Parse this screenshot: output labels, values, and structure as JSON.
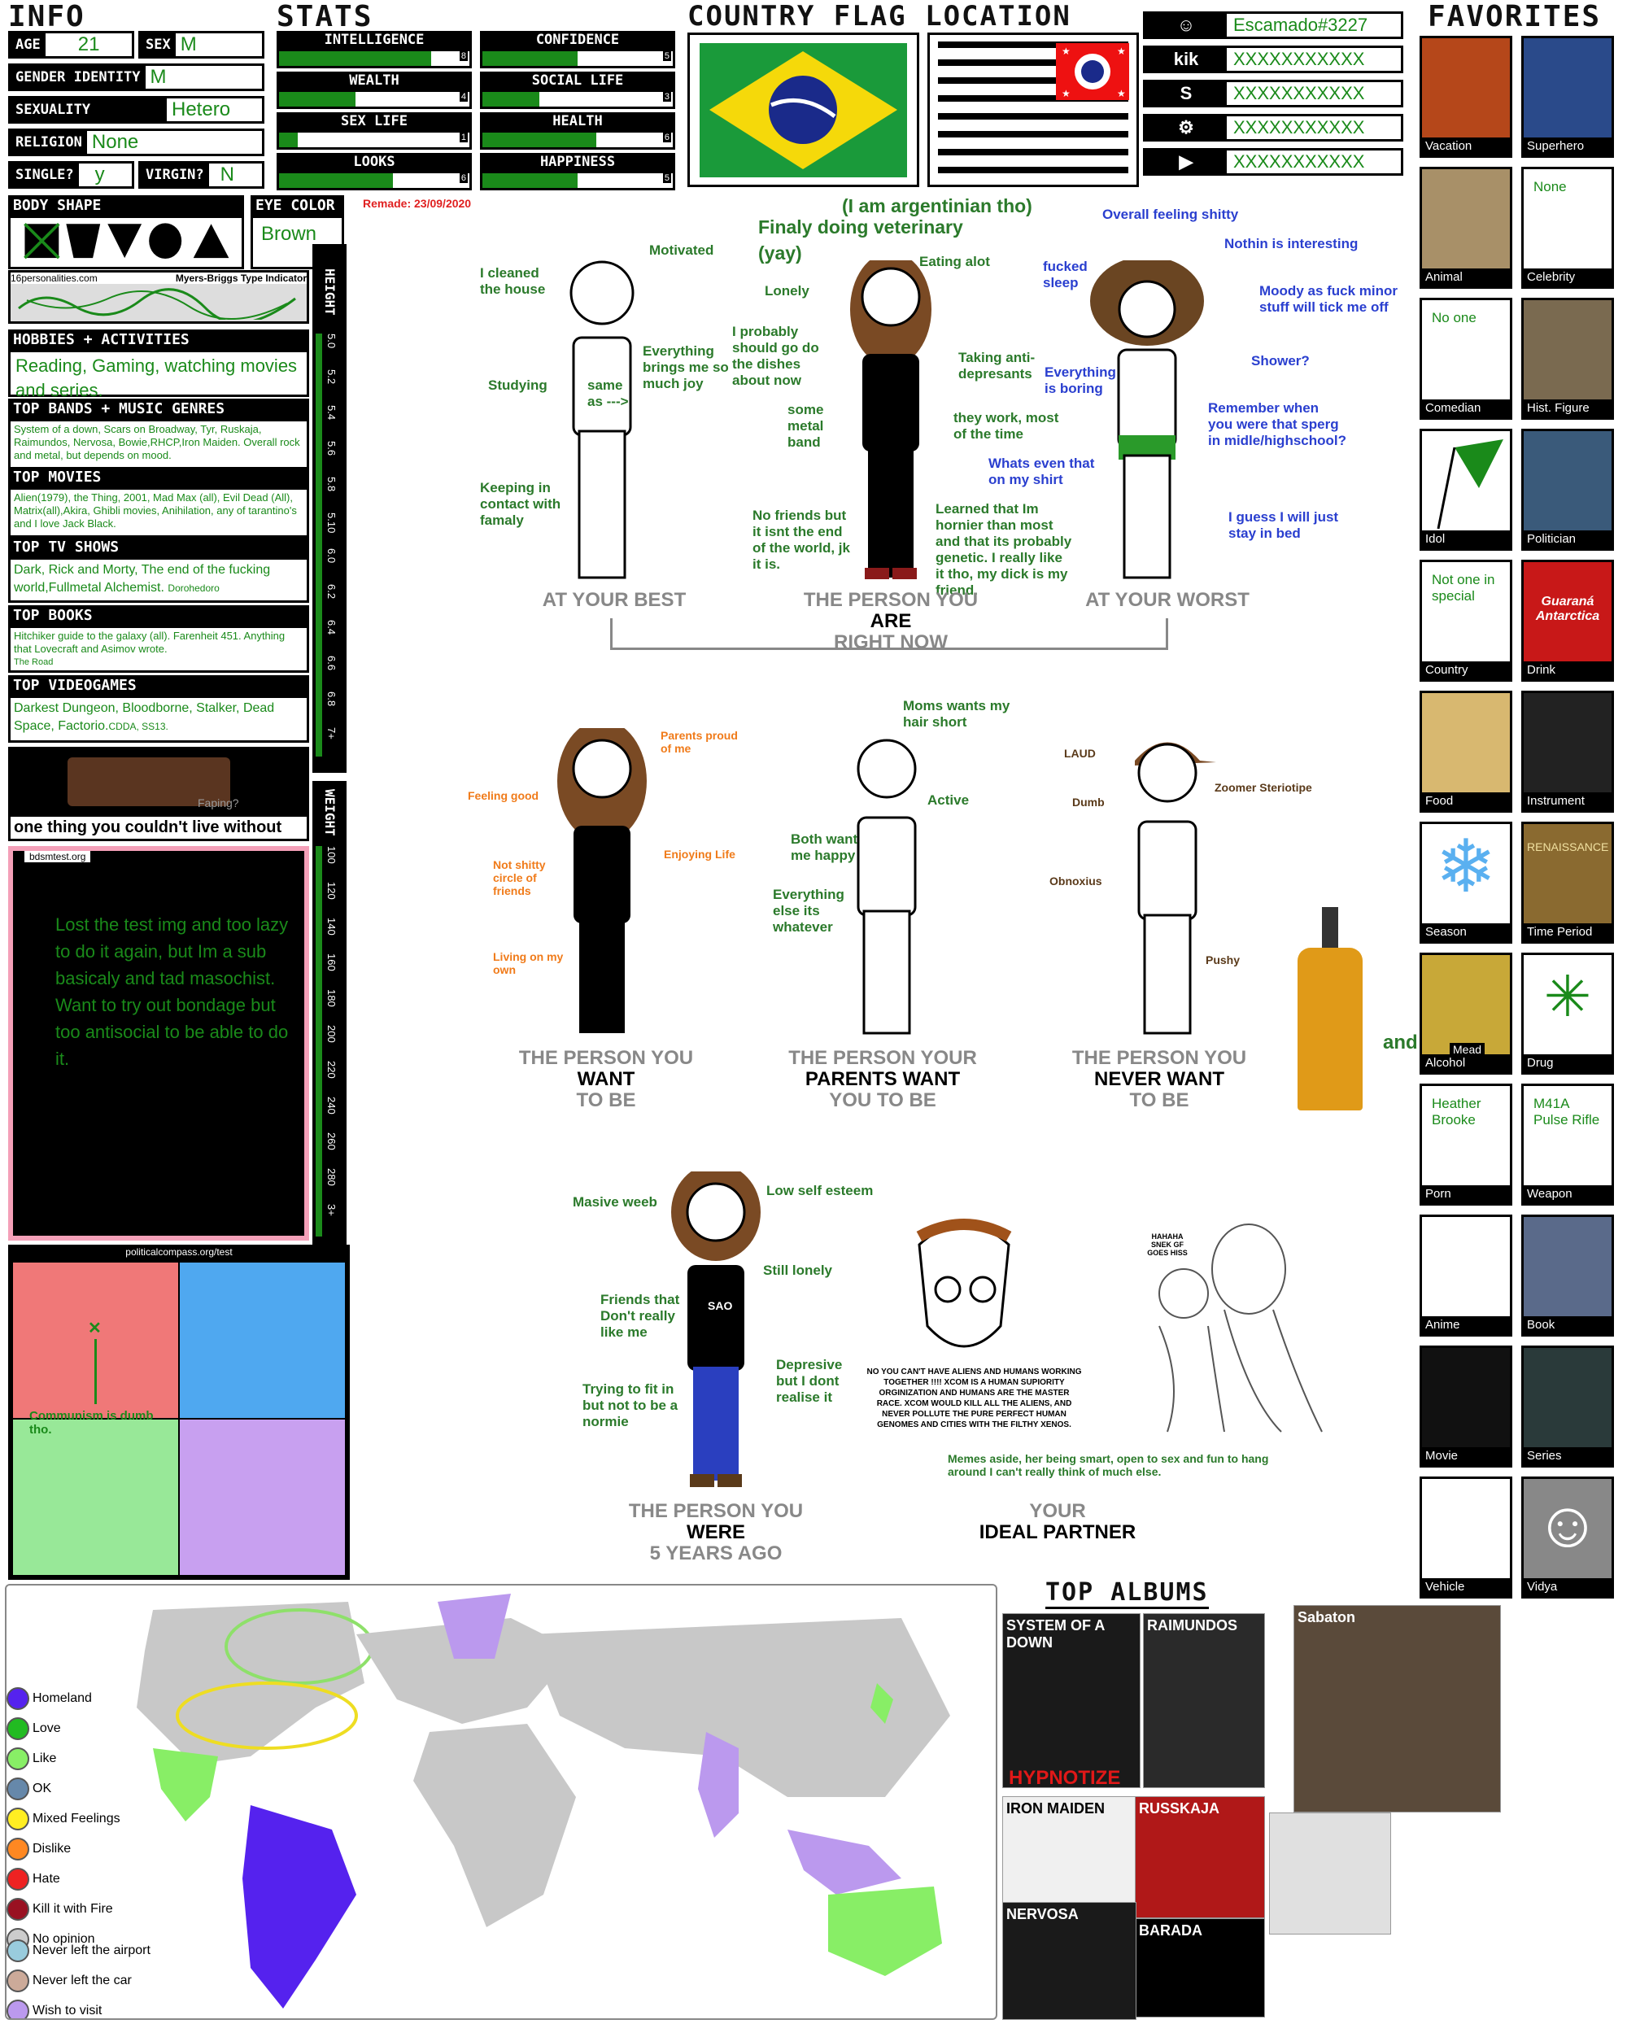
{
  "info": {
    "title": "INFO",
    "age_label": "AGE",
    "age": "21",
    "sex_label": "SEX",
    "sex": "M",
    "gender_label": "GENDER IDENTITY",
    "gender": "M",
    "sexuality_label": "SEXUALITY",
    "sexuality": "Hetero",
    "religion_label": "RELIGION",
    "religion": "None",
    "single_label": "SINGLE?",
    "single": "y",
    "virgin_label": "VIRGIN?",
    "virgin": "N"
  },
  "stats": {
    "title": "STATS",
    "items": [
      {
        "label": "INTELLIGENCE",
        "value": 8
      },
      {
        "label": "CONFIDENCE",
        "value": 5
      },
      {
        "label": "WEALTH",
        "value": 4
      },
      {
        "label": "SOCIAL LIFE",
        "value": 3
      },
      {
        "label": "SEX LIFE",
        "value": 1
      },
      {
        "label": "HEALTH",
        "value": 6
      },
      {
        "label": "LOOKS",
        "value": 6
      },
      {
        "label": "HAPPINESS",
        "value": 5
      }
    ]
  },
  "flags": {
    "title": "COUNTRY FLAG LOCATION"
  },
  "accounts": [
    {
      "icon": "discord-icon",
      "value": "Escamado#3227"
    },
    {
      "icon": "kik-icon",
      "value": "XXXXXXXXXXX"
    },
    {
      "icon": "skype-icon",
      "value": "XXXXXXXXXXX"
    },
    {
      "icon": "steam-icon",
      "value": "XXXXXXXXXXX"
    },
    {
      "icon": "youtube-icon",
      "value": "XXXXXXXXXXX"
    }
  ],
  "favorites": {
    "title": "FAVORITES",
    "items": [
      {
        "cap": "Vacation",
        "text": ""
      },
      {
        "cap": "Superhero",
        "text": ""
      },
      {
        "cap": "Animal",
        "text": ""
      },
      {
        "cap": "Celebrity",
        "text": "None"
      },
      {
        "cap": "Comedian",
        "text": "No one"
      },
      {
        "cap": "Hist. Figure",
        "text": ""
      },
      {
        "cap": "Idol",
        "text": ""
      },
      {
        "cap": "Politician",
        "text": ""
      },
      {
        "cap": "Country",
        "text": "Not one in special"
      },
      {
        "cap": "Drink",
        "text": ""
      },
      {
        "cap": "Food",
        "text": ""
      },
      {
        "cap": "Instrument",
        "text": ""
      },
      {
        "cap": "Season",
        "text": ""
      },
      {
        "cap": "Time Period",
        "text": ""
      },
      {
        "cap": "Alcohol",
        "text": ""
      },
      {
        "cap": "Drug",
        "text": ""
      },
      {
        "cap": "Porn",
        "text": "Heather Brooke"
      },
      {
        "cap": "Weapon",
        "text": "M41A Pulse Rifle"
      },
      {
        "cap": "Anime",
        "text": ""
      },
      {
        "cap": "Book",
        "text": ""
      },
      {
        "cap": "Movie",
        "text": ""
      },
      {
        "cap": "Series",
        "text": ""
      },
      {
        "cap": "Vehicle",
        "text": ""
      },
      {
        "cap": "Vidya",
        "text": ""
      }
    ],
    "mead_label": "Mead",
    "and_label": "and",
    "drink_brand": "Guaraná Antarctica",
    "time_period_sign": "RENAISSANCE"
  },
  "body": {
    "shape_title": "BODY SHAPE",
    "eye_title": "EYE COLOR",
    "eye": "Brown",
    "remade": "Remade: 23/09/2020",
    "mbti_site": "16personalities.com",
    "mbti_title": "Myers-Briggs Type Indicator",
    "height_label": "HEIGHT",
    "weight_label": "WEIGHT",
    "height_ticks": [
      "5.0",
      "5.2",
      "5.4",
      "5.6",
      "5.8",
      "5.10",
      "6.0",
      "6.2",
      "6.4",
      "6.6",
      "6.8",
      "7+"
    ],
    "weight_ticks": [
      "100",
      "120",
      "140",
      "160",
      "180",
      "200",
      "220",
      "240",
      "260",
      "280",
      "3+"
    ]
  },
  "lists": {
    "hobbies_title": "HOBBIES + ACTIVITIES",
    "hobbies": "Reading, Gaming, watching movies and series.",
    "bands_title": "TOP BANDS + MUSIC GENRES",
    "bands": "System of a down, Scars on Broadway, Tyr, Ruskaja, Raimundos, Nervosa, Bowie,RHCP,Iron Maiden. Overall rock and metal, but depends on mood.",
    "movies_title": "TOP MOVIES",
    "movies": "Alien(1979), the Thing, 2001, Mad Max (all), Evil Dead (All), Matrix(all),Akira, Ghibli movies, Anihilation, any of tarantino's and I love Jack Black.",
    "tv_title": "TOP TV SHOWS",
    "tv": "Dark, Rick and Morty, The end of the fucking world,Fullmetal Alchemist.",
    "tv_small": "Dorohedoro",
    "books_title": "TOP BOOKS",
    "books": "Hitchiker guide to the galaxy (all). Farenheit 451. Anything that Lovecraft and Asimov wrote.",
    "books_small": "The Road",
    "games_title": "TOP VIDEOGAMES",
    "games": "Darkest Dungeon, Bloodborne, Stalker, Dead Space, Factorio.",
    "games_small": "CDDA, SS13.",
    "couldnt_live": "one thing you couldn't live without",
    "faping": "Faping?"
  },
  "bdsm": {
    "site": "bdsmtest.org",
    "text": "Lost the test img and too lazy to do it again, but Im a sub basicaly and tad masochist. Want to try out bondage but too antisocial to be able to do it."
  },
  "compass": {
    "site": "politicalcompass.org/test",
    "note": "Communism is dumb tho."
  },
  "comic": {
    "heading1": "(I am argentinian tho)",
    "heading2": "Finaly doing veterinary",
    "heading3": "(yay)",
    "best": [
      "I cleaned the house",
      "Motivated",
      "Studying",
      "same as --->",
      "Everything brings me so much joy",
      "Keeping in contact with famaly"
    ],
    "now": [
      "Lonely",
      "Eating alot",
      "I probably should go do the dishes about now",
      "some metal band",
      "Taking anti-depresants",
      "they work, most of the time",
      "No friends but it isnt the end of the world, jk it is.",
      "Learned that Im hornier than most and that its probably genetic. I really like it tho, my dick is my friend."
    ],
    "worst": [
      "Overall feeling shitty",
      "Nothin is interesting",
      "fucked sleep",
      "Moody as fuck minor stuff will tick me off",
      "Everything is boring",
      "Shower?",
      "Remember when you were that sperg in midle/highschool?",
      "Whats even that on my shirt",
      "I guess I will just stay in bed"
    ],
    "cap_best": "AT YOUR BEST",
    "cap_now1": "THE PERSON YOU",
    "cap_now2": "ARE",
    "cap_now3": "RIGHT NOW",
    "cap_worst": "AT YOUR WORST",
    "want": [
      "Parents proud of me",
      "Feeling good",
      "Enjoying Life",
      "Not shitty circle of friends",
      "Living on my own"
    ],
    "parents": [
      "Moms wants my hair short",
      "Active",
      "Both want me happy",
      "Everything else its whatever"
    ],
    "never": [
      "LAUD",
      "Dumb",
      "Zoomer Steriotipe",
      "Obnoxius",
      "Pushy"
    ],
    "cap_want1": "THE PERSON YOU",
    "cap_want2": "WANT",
    "cap_want3": "TO BE",
    "cap_par1": "THE PERSON YOUR",
    "cap_par2": "PARENTS WANT",
    "cap_par3": "YOU TO BE",
    "cap_nev1": "THE PERSON YOU",
    "cap_nev2": "NEVER WANT",
    "cap_nev3": "TO BE",
    "past": [
      "Masive weeb",
      "Low self esteem",
      "Still lonely",
      "Friends that Don't really like me",
      "Trying to fit in but not to be a normie",
      "Depresive but I dont realise it"
    ],
    "past_shirt": "SAO",
    "xcom": "NO YOU CAN'T HAVE ALIENS AND HUMANS WORKING TOGETHER !!!! XCOM IS A HUMAN SUPIORITY ORGINIZATION AND HUMANS ARE THE MASTER RACE. XCOM WOULD KILL ALL THE ALIENS, AND NEVER POLLUTE THE PURE PERFECT HUMAN GENOMES AND CITIES WITH THE FILTHY XENOS.",
    "snek": "HAHAHA SNEK GF GOES HISS",
    "partner_note": "Memes aside, her being smart, open to sex and fun to hang around I can't really think of much else.",
    "cap_past1": "THE PERSON YOU",
    "cap_past2": "WERE",
    "cap_past3": "5 YEARS AGO",
    "cap_ideal1": "YOUR",
    "cap_ideal2": "IDEAL PARTNER"
  },
  "map": {
    "legend": [
      "Homeland",
      "Love",
      "Like",
      "OK",
      "Mixed Feelings",
      "Dislike",
      "Hate",
      "Kill it with Fire",
      "No opinion"
    ],
    "legend_colors": [
      "#5522ee",
      "#22bb22",
      "#88ee66",
      "#6688aa",
      "#ffee22",
      "#ff8822",
      "#ee2222",
      "#991122",
      "#cccccc"
    ],
    "legend2": [
      "Never left the airport",
      "Never left the car",
      "Wish to visit"
    ],
    "legend2_colors": [
      "#99ccdd",
      "#ccaa99",
      "#bb99ee"
    ]
  },
  "albums": {
    "title": "TOP ALBUMS",
    "items": [
      "SYSTEM OF A DOWN",
      "HYPNOTIZE",
      "RAIMUNDOS",
      "Sabaton",
      "IRON MAIDEN",
      "RUSSKAJA",
      "BARADA",
      "NERVOSA",
      ""
    ]
  }
}
